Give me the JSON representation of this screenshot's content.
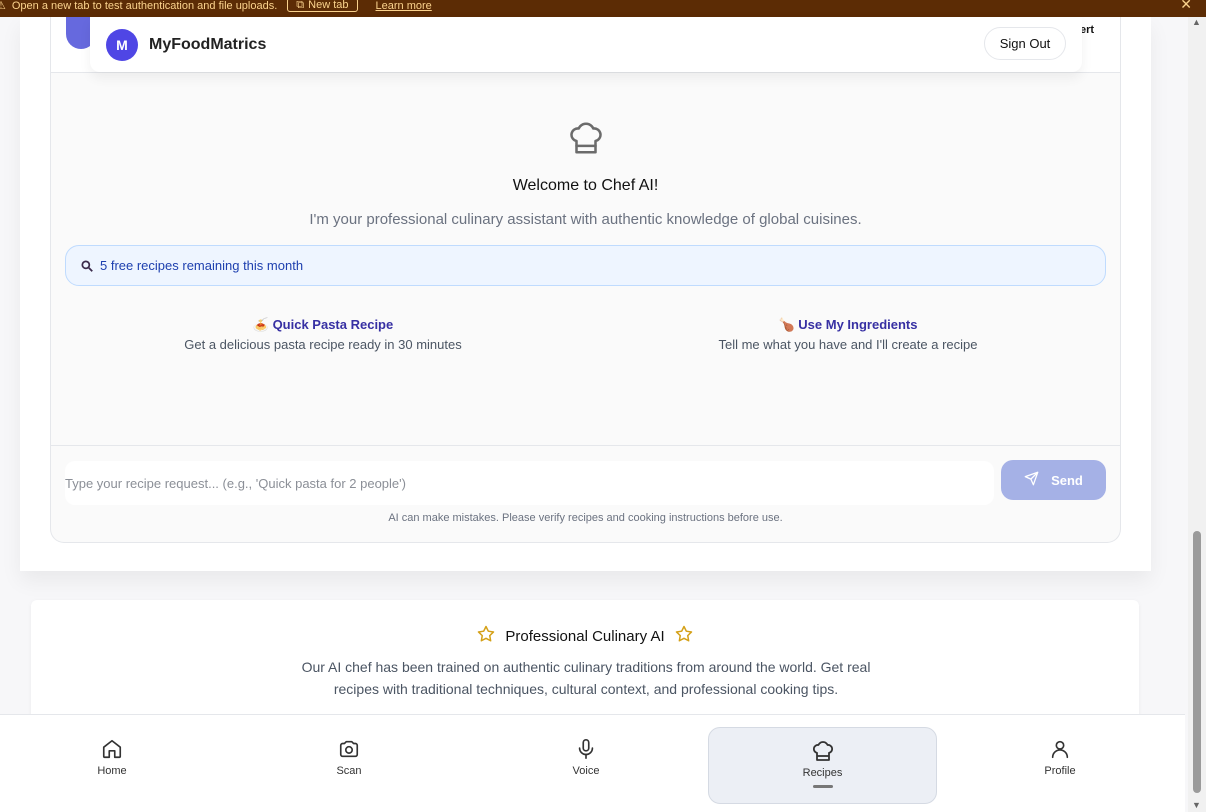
{
  "banner": {
    "message": "Open a new tab to test authentication and file uploads.",
    "new_tab_label": "New tab",
    "learn_more": "Learn more"
  },
  "header": {
    "avatar_initial": "M",
    "app_title": "MyFoodMatrics",
    "sign_out": "Sign Out",
    "side_text": "ert"
  },
  "chat": {
    "welcome": "Welcome to Chef AI!",
    "subtitle": "I'm your professional culinary assistant with authentic knowledge of global cuisines.",
    "quota": "5 free recipes remaining this month",
    "suggestions": [
      {
        "emoji": "🍝",
        "title": "Quick Pasta Recipe",
        "desc": "Get a delicious pasta recipe ready in 30 minutes"
      },
      {
        "emoji": "🍗",
        "title": "Use My Ingredients",
        "desc": "Tell me what you have and I'll create a recipe"
      }
    ],
    "input_placeholder": "Type your recipe request... (e.g., 'Quick pasta for 2 people')",
    "send_label": "Send",
    "disclaimer": "AI can make mistakes. Please verify recipes and cooking instructions before use."
  },
  "info": {
    "title": "Professional Culinary AI",
    "body": "Our AI chef has been trained on authentic culinary traditions from around the world. Get real recipes with traditional techniques, cultural context, and professional cooking tips."
  },
  "nav": {
    "home": "Home",
    "scan": "Scan",
    "voice": "Voice",
    "recipes": "Recipes",
    "profile": "Profile",
    "active": "Recipes"
  },
  "colors": {
    "accent": "#4f46e5",
    "banner_bg": "#5c2c05",
    "send_bg": "#a5b1e6"
  }
}
